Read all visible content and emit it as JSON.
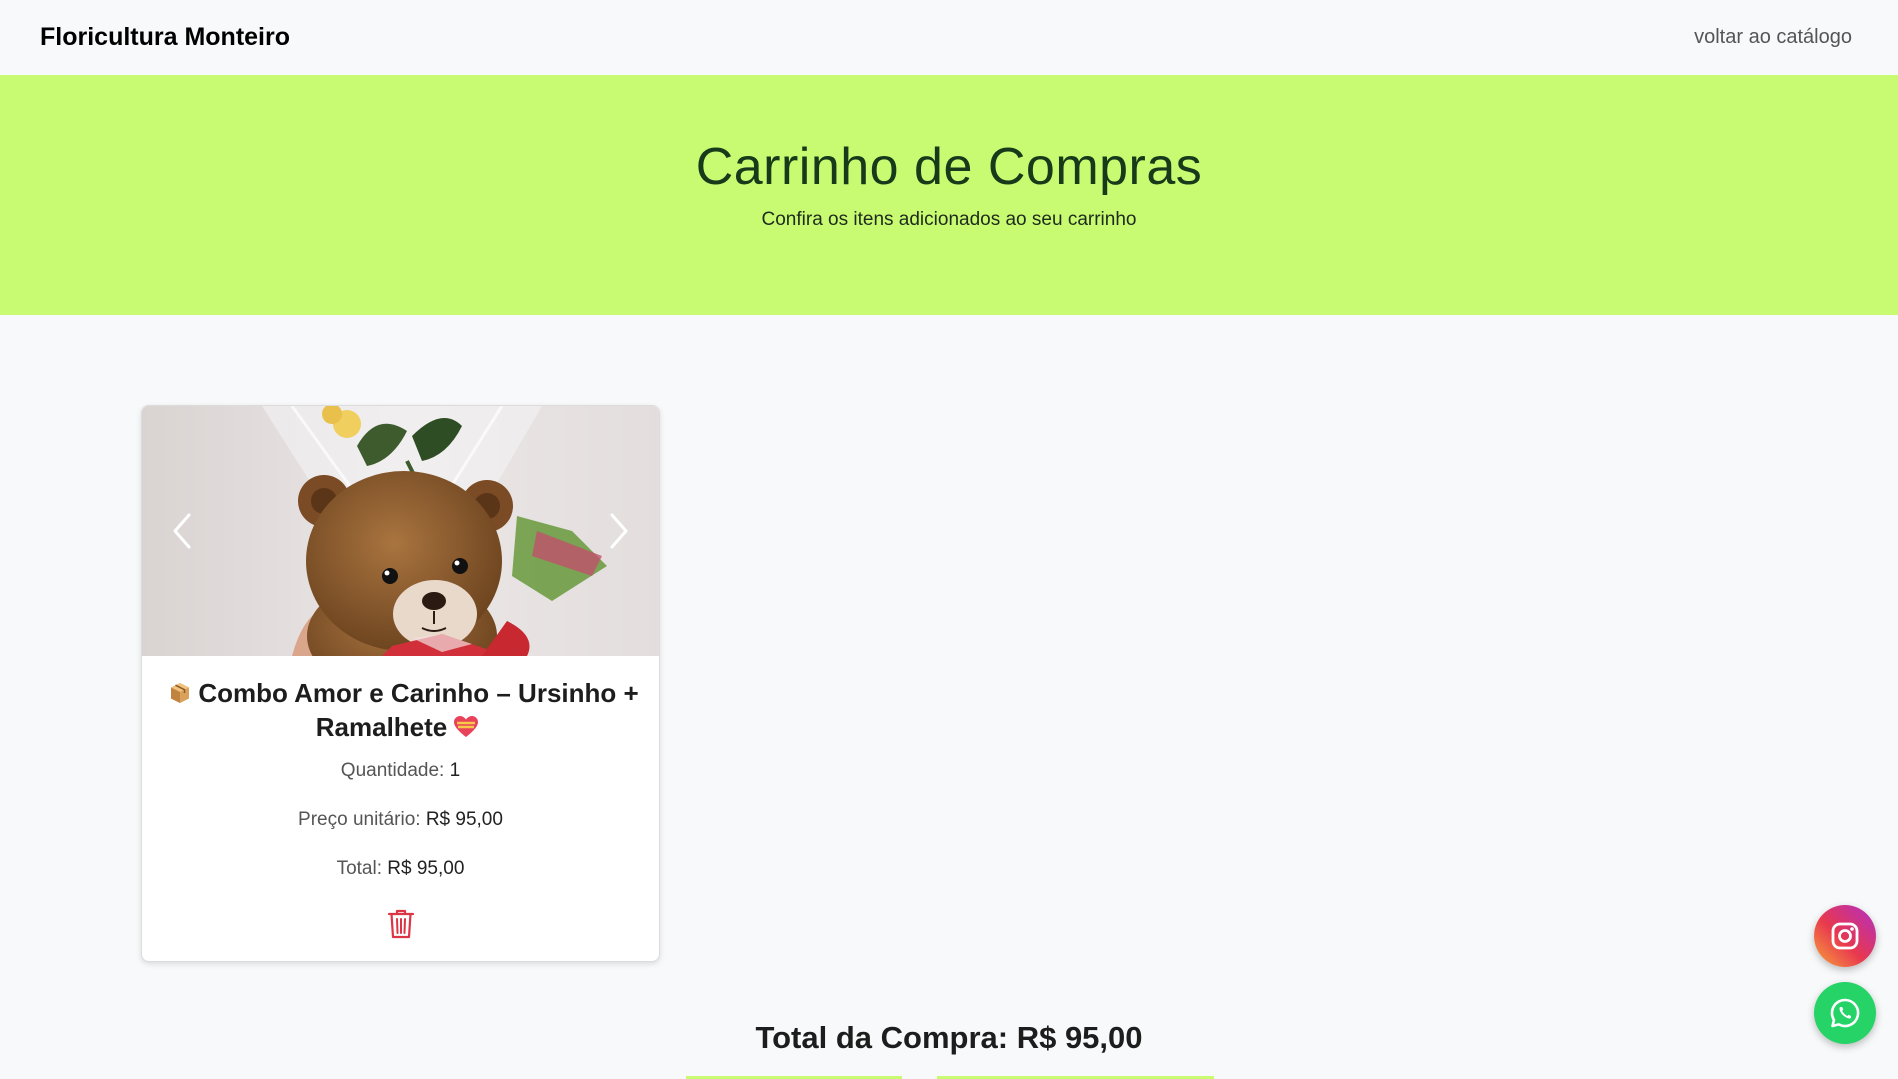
{
  "navbar": {
    "brand": "Floricultura Monteiro",
    "back_link": "voltar ao catálogo"
  },
  "hero": {
    "title": "Carrinho de Compras",
    "subtitle": "Confira os itens adicionados ao seu carrinho"
  },
  "cart": {
    "items": [
      {
        "title": "Combo Amor e Carinho – Ursinho + Ramalhete",
        "leading_icon": "package-icon",
        "trailing_icon": "heart-icon",
        "quantity_label": "Quantidade:",
        "quantity": "1",
        "unit_price_label": "Preço unitário:",
        "unit_price": "R$ 95,00",
        "total_label": "Total:",
        "total": "R$ 95,00"
      }
    ]
  },
  "summary": {
    "total_text": "Total da Compra: R$ 95,00"
  },
  "colors": {
    "hero_bg": "#c8fb71",
    "trash": "#dc3545",
    "whatsapp": "#25d366"
  }
}
